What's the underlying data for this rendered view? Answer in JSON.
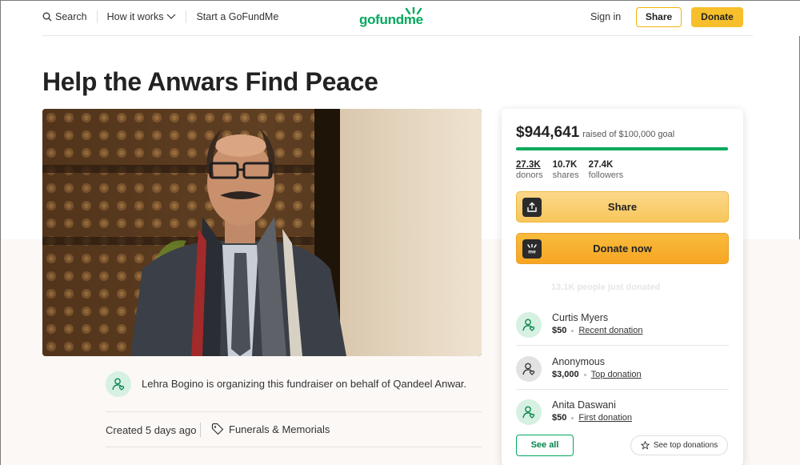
{
  "header": {
    "search_label": "Search",
    "how_it_works_label": "How it works",
    "start_label": "Start a GoFundMe",
    "logo_text": "gofundme",
    "signin_label": "Sign in",
    "share_label": "Share",
    "donate_label": "Donate"
  },
  "page": {
    "title": "Help the Anwars Find Peace"
  },
  "organizer": {
    "text": "Lehra Bogino is organizing this fundraiser on behalf of Qandeel Anwar."
  },
  "meta": {
    "created": "Created 5 days ago",
    "category": "Funerals & Memorials"
  },
  "card": {
    "raised_amount": "$944,641",
    "goal_text": "raised of $100,000 goal",
    "progress_fraction": 1.0,
    "stats": {
      "donors_count": "27.3K",
      "donors_label": "donors",
      "shares_count": "10.7K",
      "shares_label": "shares",
      "followers_count": "27.4K",
      "followers_label": "followers"
    },
    "share_button": "Share",
    "donate_button": "Donate now",
    "ghost_text": "13.1K people just donated",
    "donations": [
      {
        "name": "Curtis Myers",
        "amount": "$50",
        "tag": "Recent donation"
      },
      {
        "name": "Anonymous",
        "amount": "$3,000",
        "tag": "Top donation"
      },
      {
        "name": "Anita Daswani",
        "amount": "$50",
        "tag": "First donation"
      }
    ],
    "see_all": "See all",
    "see_top": "See top donations"
  },
  "colors": {
    "brand_green": "#02a95c",
    "donate_yellow": "#f7bf2b"
  }
}
